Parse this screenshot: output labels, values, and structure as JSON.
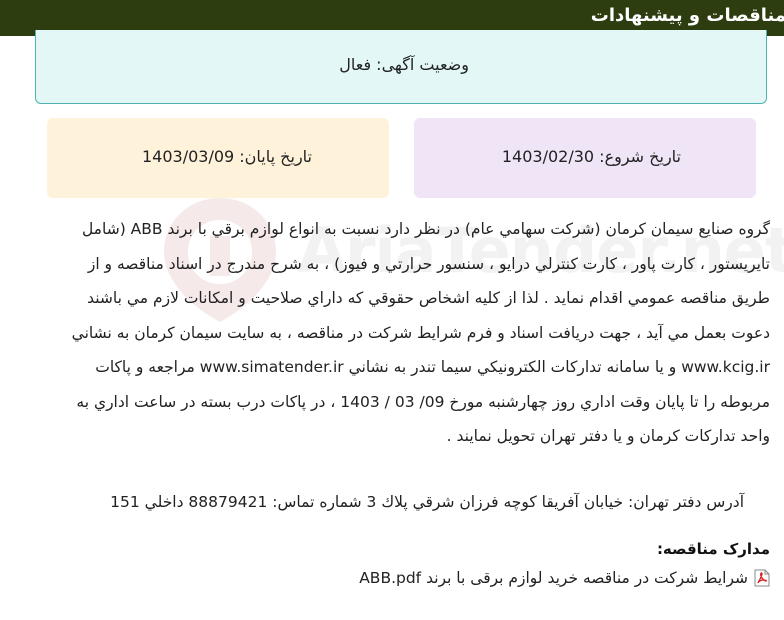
{
  "header": {
    "title": "مناقصات و پیشنهادات"
  },
  "status": {
    "text": "وضعیت آگهی: فعال"
  },
  "dates": {
    "start": "تاریخ شروع: 1403/02/30",
    "end": "تاریخ پایان: 1403/03/09"
  },
  "watermark": {
    "text": "AriaTender.net"
  },
  "body": {
    "lines": [
      "گروه صنايع سيمان كرمان (شركت سهامي عام) در نظر دارد نسبت به انواع لوازم برقي با برند ABB (شامل",
      "تايريستور ، كارت پاور ، كارت كنترلي درايو ، سنسور حرارتي و فيوز) ، به شرح مندرج در اسناد مناقصه و از",
      "طريق مناقصه عمومي اقدام نمايد . لذا از كليه اشخاص حقوقي كه داراي صلاحيت و امكانات لازم مي باشند",
      "دعوت بعمل مي آيد ، جهت دريافت اسناد و فرم شرايط شركت در مناقصه ، به سايت سيمان كرمان به نشاني",
      "www.kcig.ir و يا سامانه تداركات الكترونيكي سيما تندر به نشاني www.simatender.ir مراجعه و پاكات",
      "مربوطه را تا پايان وقت اداري روز چهارشنبه مورخ 09/ 03 / 1403 ، در پاكات درب بسته در ساعت اداري به",
      "واحد تداركات كرمان و يا دفتر تهران تحويل نمايند ."
    ]
  },
  "address": {
    "text": "آدرس دفتر تهران: خيابان آفريقا كوچه فرزان شرقي پلاك 3 شماره تماس: 88879421 داخلي 151"
  },
  "documents": {
    "heading": "مدارک مناقصه:",
    "items": [
      {
        "label": "شرایط شرکت در مناقصه خرید لوازم برقی با برند ABB.pdf",
        "icon": "pdf-icon"
      }
    ]
  }
}
